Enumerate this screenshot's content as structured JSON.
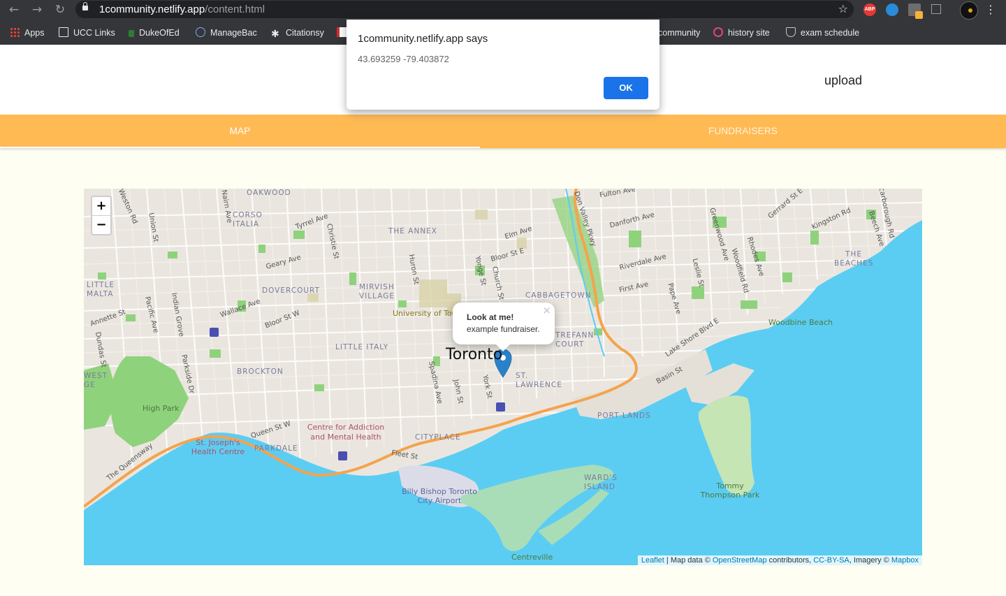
{
  "browser": {
    "url_domain": "1community.netlify.app",
    "url_path": "/content.html",
    "bookmarks": [
      "Apps",
      "UCC Links",
      "DukeOfEd",
      "ManageBac",
      "Citationsy",
      "community",
      "history site",
      "exam schedule"
    ],
    "extension_badges": {
      "adblock": "ABP"
    }
  },
  "dialog": {
    "title": "1community.netlify.app says",
    "message": "43.693259 -79.403872",
    "ok_label": "OK"
  },
  "header": {
    "upload_label": "upload"
  },
  "tabs": [
    {
      "label": "MAP",
      "active": true
    },
    {
      "label": "FUNDRAISERS",
      "active": false
    }
  ],
  "map": {
    "zoom_in": "+",
    "zoom_out": "−",
    "city_label": "Toronto",
    "popup": {
      "title": "Look at me!",
      "body": "example fundraiser.",
      "close": "×"
    },
    "attribution": {
      "leaflet": "Leaflet",
      "sep1": " | Map data © ",
      "osm": "OpenStreetMap",
      "mid": " contributors, ",
      "license": "CC-BY-SA",
      "imagery": ", Imagery © ",
      "mapbox": "Mapbox"
    },
    "neighbourhoods": [
      "OAKWOOD",
      "CORSO ITALIA",
      "THE ANNEX",
      "LITTLE MALTA",
      "DOVERCOURT",
      "MIRVISH VILLAGE",
      "CABBAGETOWN",
      "LITTLE ITALY",
      "BROCKTON",
      "ST. LAWRENCE",
      "CITYPLACE",
      "PARKDALE",
      "PORT LANDS",
      "WARD'S ISLAND",
      "THE BEACHES",
      "WEST GE",
      "TREFANN COURT"
    ],
    "streets": [
      "Nairn Ave",
      "Union St",
      "Tyrrel Ave",
      "Christie St",
      "Huron St",
      "Yonge St",
      "Bloor St E",
      "Elm Ave",
      "Don Valley Pkwy",
      "Danforth Ave",
      "Fulton Ave",
      "Gerrard St E",
      "Kingston Rd",
      "Greenwood Ave",
      "Rhodes Ave",
      "Woodfield Rd",
      "Leslie St",
      "Riverdale Ave",
      "First Ave",
      "Pape Ave",
      "Geary Ave",
      "Wallace Ave",
      "Bloor St W",
      "Pacific Ave",
      "Indian Grove",
      "Annette St",
      "Dundas St",
      "Parkside Dr",
      "Queen St W",
      "The Queensway",
      "Spadina Ave",
      "John St",
      "York St",
      "Church St",
      "Lake Shore Blvd E",
      "Basin St",
      "Fleet St",
      "Beech Ave",
      "Scarborough Rd",
      "Weston Rd"
    ],
    "pois": {
      "university": "University of Tor",
      "high_park": "High Park",
      "st_josephs": "St. Joseph's Health Centre",
      "camh": "Centre for Addiction and Mental Health",
      "airport": "Billy Bishop Toronto City Airport",
      "centreville": "Centreville",
      "tommy": "Tommy Thompson Park",
      "woodbine": "Woodbine Beach"
    },
    "colors": {
      "water": "#5bcdf3",
      "park": "#8fd27c",
      "highway": "#f5a34d",
      "land": "#eae6df"
    }
  },
  "colors": {
    "tab_bar": "#ffba54",
    "page_bg": "#fefef2",
    "ok_button": "#1a73e8"
  }
}
